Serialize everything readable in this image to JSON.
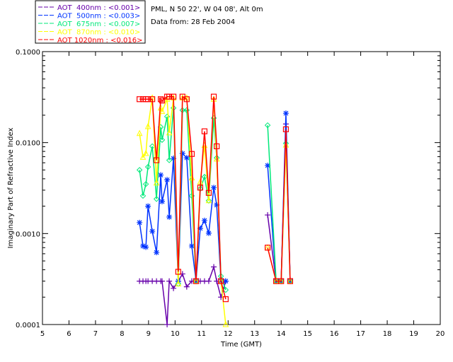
{
  "header": {
    "site": "PML, N 50 22', W 04 08', Alt 0m",
    "date": "Data from: 28 Feb 2004"
  },
  "chart_data": {
    "type": "line",
    "title": "",
    "xlabel": "Time (GMT)",
    "ylabel": "Imaginary Part of Refractive Index",
    "xlim": [
      5,
      20
    ],
    "ylim": [
      0.0001,
      0.1
    ],
    "yscale": "log",
    "grid": false,
    "legend_position": "top-left (outside plot)",
    "x_ticks": [
      "5",
      "6",
      "7",
      "8",
      "9",
      "10",
      "11",
      "12",
      "13",
      "14",
      "15",
      "16",
      "17",
      "18",
      "19",
      "20"
    ],
    "y_ticks": [
      "0.1000",
      "0.0100",
      "0.0010",
      "0.0001"
    ],
    "x": [
      8.66,
      8.79,
      8.9,
      8.98,
      9.14,
      9.3,
      9.46,
      9.51,
      9.7,
      9.78,
      9.94,
      10.12,
      10.28,
      10.44,
      10.63,
      10.79,
      10.95,
      11.11,
      11.27,
      11.46,
      11.57,
      11.73,
      11.91,
      13.49,
      13.81,
      14.0,
      14.18,
      14.34
    ],
    "series": [
      {
        "name": "AOT  400nm : <0.001>",
        "color": "#6600aa",
        "marker": "plus",
        "values": [
          0.0003,
          0.0003,
          0.0003,
          0.0003,
          0.0003,
          0.0003,
          0.0003,
          0.0003,
          0.0001,
          0.0003,
          0.00025,
          0.0003,
          0.00036,
          0.00026,
          0.0003,
          0.0003,
          0.0003,
          0.0003,
          0.0003,
          0.00043,
          0.0003,
          0.0002,
          0.0003,
          0.0016,
          0.0003,
          0.0003,
          0.016,
          0.0003
        ]
      },
      {
        "name": "AOT  500nm : <0.003>",
        "color": "#0033ff",
        "marker": "asterisk",
        "values": [
          0.00132,
          0.00073,
          0.00071,
          0.002,
          0.00106,
          0.00062,
          0.0044,
          0.00225,
          0.0039,
          0.00152,
          0.0067,
          0.0003,
          0.0076,
          0.0068,
          0.00073,
          0.0003,
          0.00114,
          0.00139,
          0.00101,
          0.0032,
          0.00206,
          0.0003,
          0.0003,
          0.0056,
          0.0003,
          0.0003,
          0.021,
          0.0003
        ]
      },
      {
        "name": "AOT  675nm : <0.007>",
        "color": "#00e87a",
        "marker": "diamond",
        "values": [
          0.005,
          0.0026,
          0.0035,
          0.0054,
          0.0091,
          0.0024,
          0.0148,
          0.0107,
          0.0193,
          0.0064,
          0.024,
          0.00028,
          0.0227,
          0.0227,
          0.0026,
          0.0003,
          0.0031,
          0.0042,
          0.0023,
          0.0186,
          0.0068,
          0.00034,
          0.00024,
          0.0155,
          0.0003,
          0.0003,
          0.0098,
          0.0003
        ]
      },
      {
        "name": "AOT  870nm : <0.010>",
        "color": "#ffff00",
        "marker": "triangle",
        "values": [
          0.0126,
          0.0069,
          0.0076,
          0.015,
          0.031,
          0.0036,
          0.024,
          0.022,
          0.03,
          0.0128,
          0.031,
          0.00028,
          0.031,
          0.031,
          0.0041,
          0.0003,
          0.0037,
          0.0093,
          0.0023,
          0.03,
          0.0066,
          0.0003,
          0.0001,
          0.0007,
          0.0003,
          0.0003,
          0.0094,
          0.0003
        ]
      },
      {
        "name": "AOT 1020nm : <0.016>",
        "color": "#ff0000",
        "marker": "square",
        "values": [
          0.03,
          0.03,
          0.03,
          0.03,
          0.03,
          0.0064,
          0.03,
          0.029,
          0.032,
          0.032,
          0.032,
          0.00038,
          0.032,
          0.03,
          0.0075,
          0.0003,
          0.0032,
          0.0133,
          0.0028,
          0.032,
          0.0091,
          0.0003,
          0.00019,
          0.0007,
          0.0003,
          0.0003,
          0.014,
          0.0003
        ]
      }
    ]
  }
}
